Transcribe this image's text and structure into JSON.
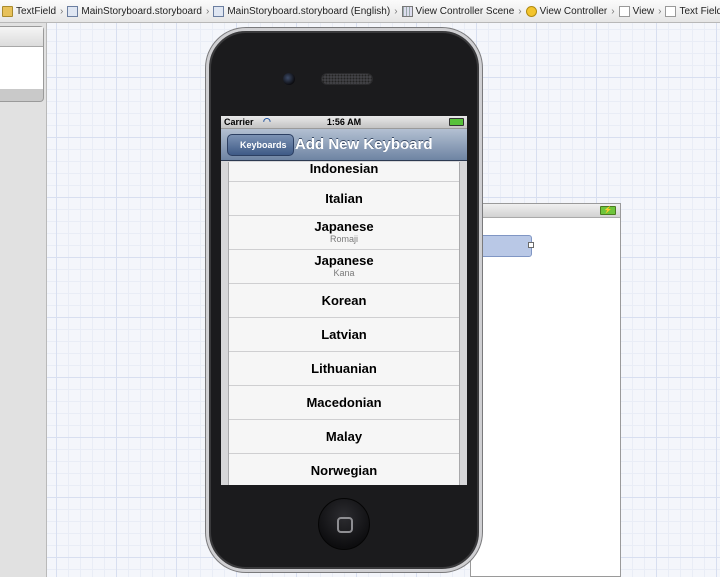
{
  "breadcrumb": {
    "items": [
      {
        "label": "TextField",
        "icon": "folder-icon"
      },
      {
        "label": "MainStoryboard.storyboard",
        "icon": "storyboard-file-icon"
      },
      {
        "label": "MainStoryboard.storyboard (English)",
        "icon": "storyboard-file-icon"
      },
      {
        "label": "View Controller Scene",
        "icon": "scene-icon"
      },
      {
        "label": "View Controller",
        "icon": "view-controller-icon"
      },
      {
        "label": "View",
        "icon": "view-icon"
      },
      {
        "label": "Text Field",
        "icon": "view-icon"
      }
    ]
  },
  "simulator": {
    "status_bar": {
      "carrier": "Carrier",
      "time": "1:56 AM"
    },
    "nav": {
      "back_label": "Keyboards",
      "title": "Add New Keyboard"
    },
    "rows": [
      {
        "label": "Indonesian",
        "sub": ""
      },
      {
        "label": "Italian",
        "sub": ""
      },
      {
        "label": "Japanese",
        "sub": "Romaji"
      },
      {
        "label": "Japanese",
        "sub": "Kana"
      },
      {
        "label": "Korean",
        "sub": ""
      },
      {
        "label": "Latvian",
        "sub": ""
      },
      {
        "label": "Lithuanian",
        "sub": ""
      },
      {
        "label": "Macedonian",
        "sub": ""
      },
      {
        "label": "Malay",
        "sub": ""
      },
      {
        "label": "Norwegian",
        "sub": ""
      }
    ]
  },
  "colors": {
    "nav_top": "#b3c0d2",
    "nav_bottom": "#6e84a3",
    "battery": "#57c13a",
    "selection": "#b9c8e6"
  }
}
